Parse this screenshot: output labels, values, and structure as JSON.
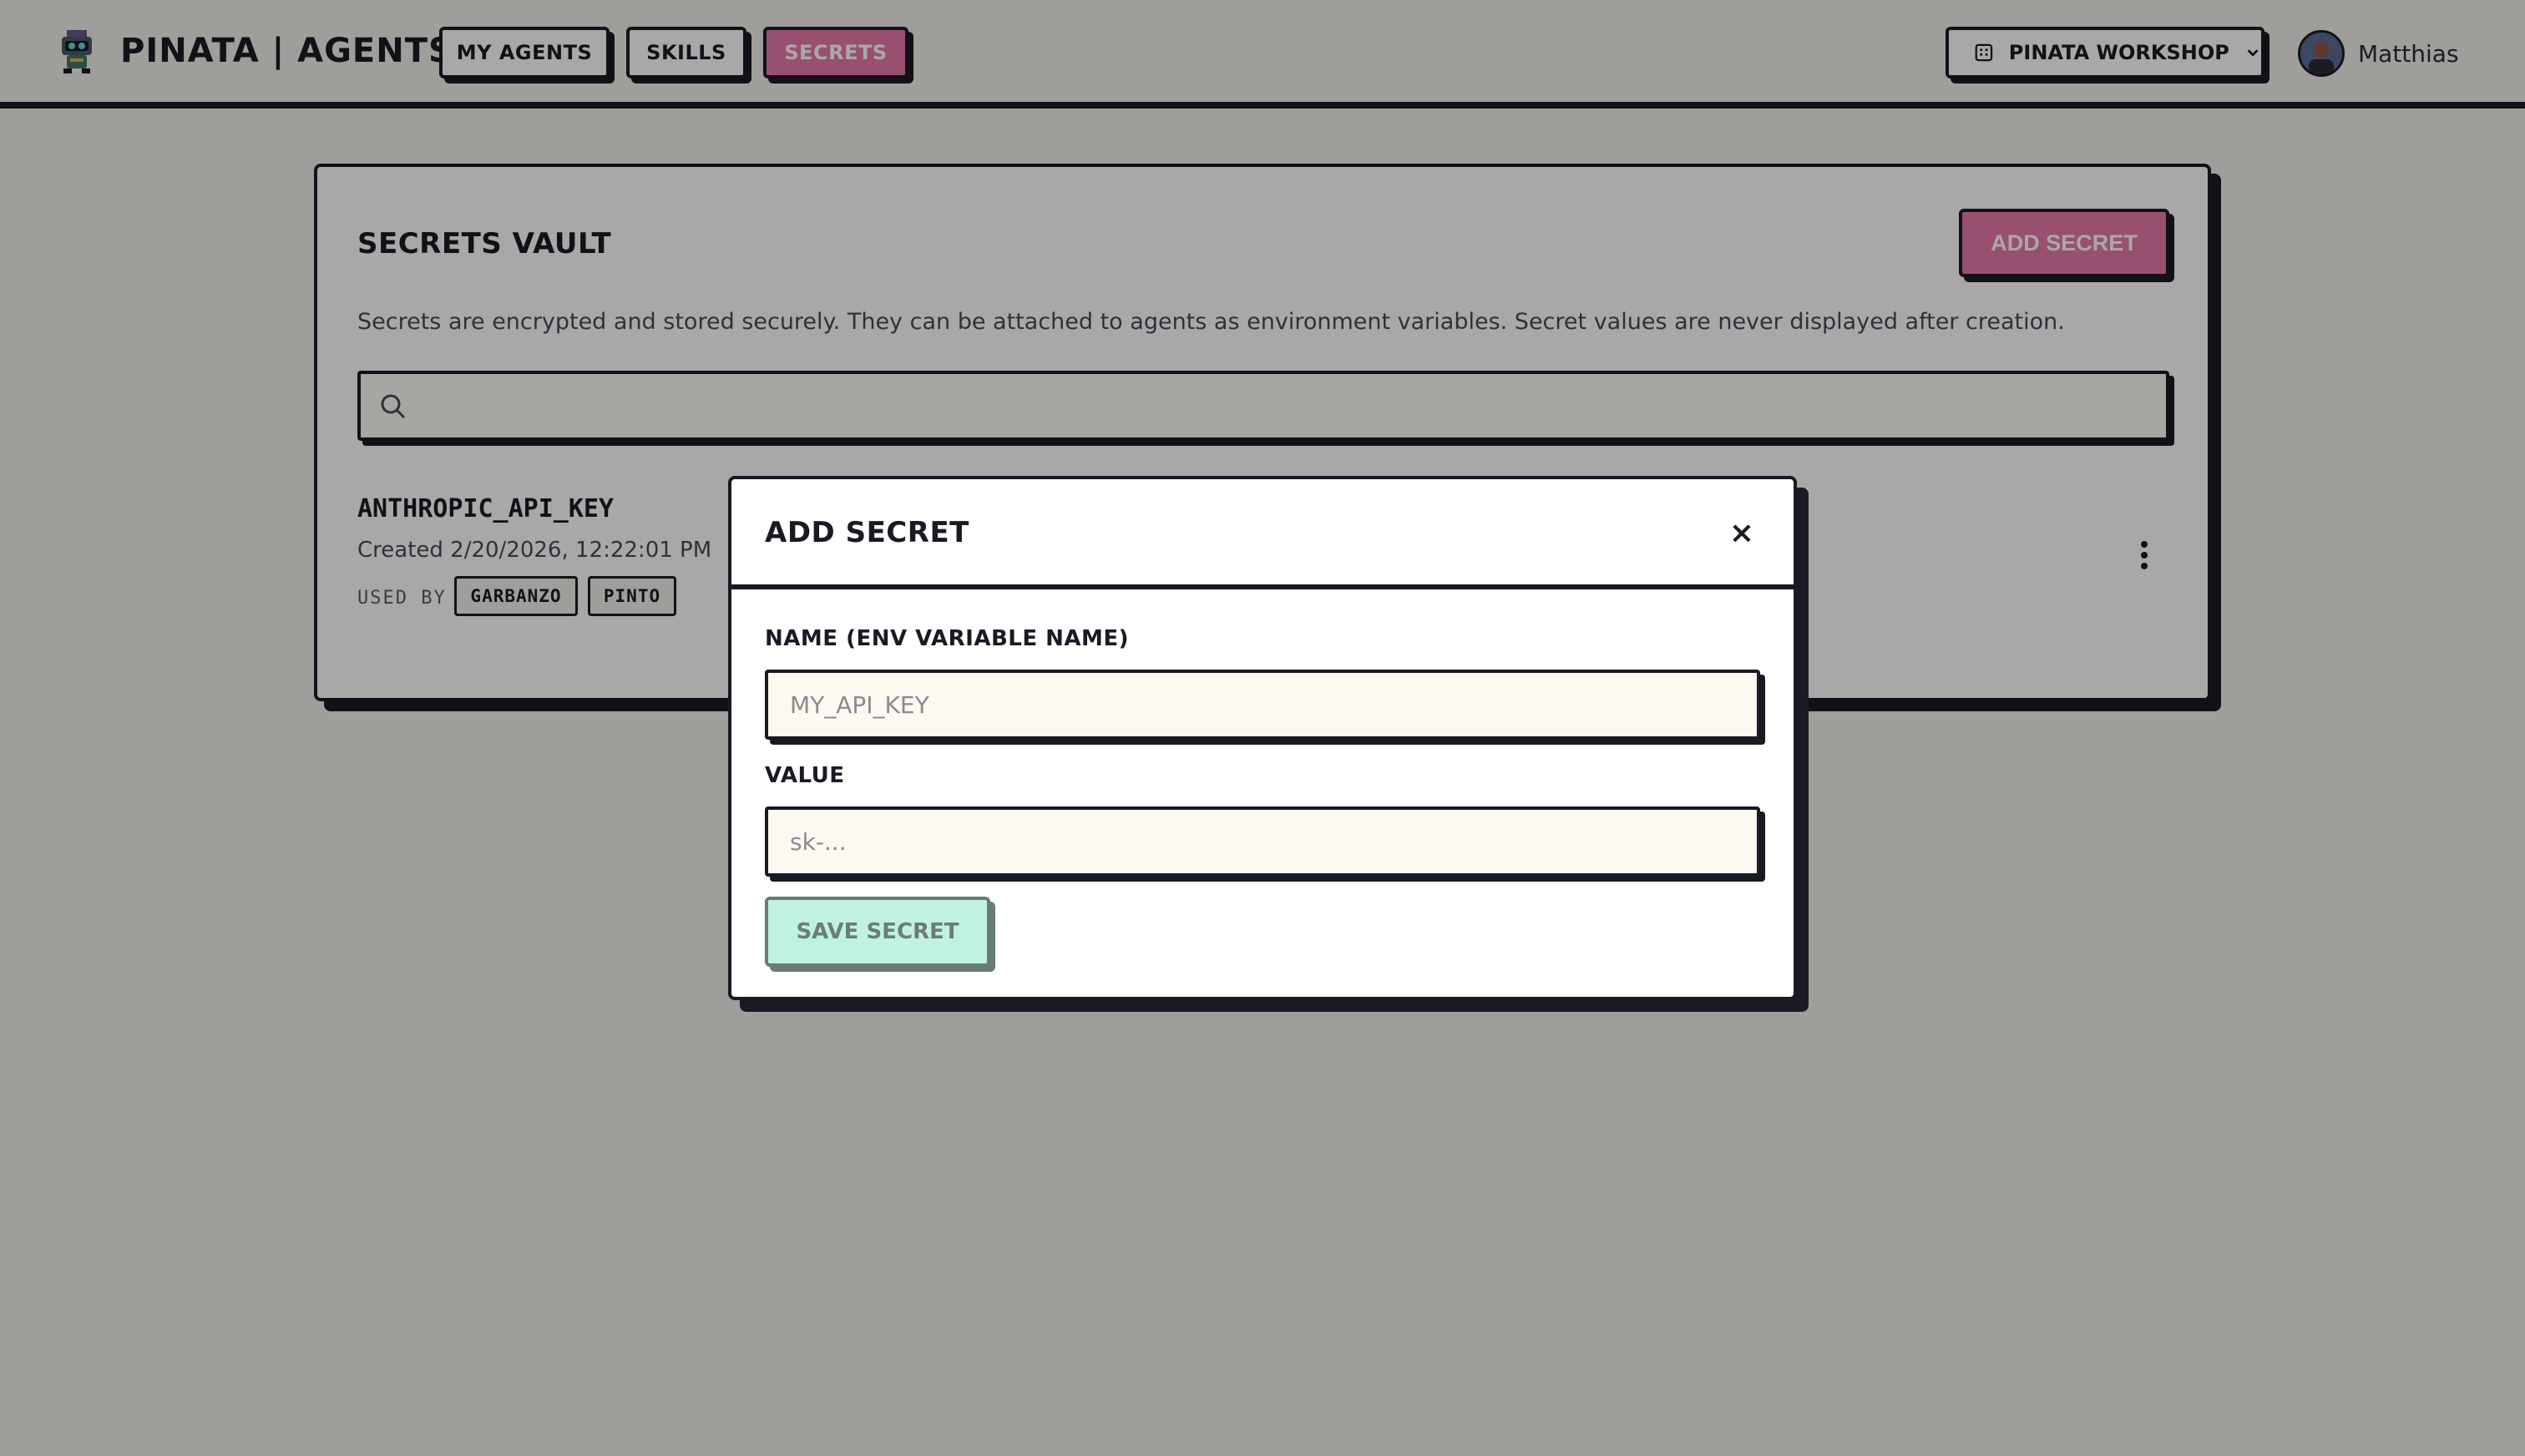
{
  "header": {
    "brand": "PINATA | AGENTS",
    "nav": [
      {
        "label": "MY AGENTS",
        "active": false
      },
      {
        "label": "SKILLS",
        "active": false
      },
      {
        "label": "SECRETS",
        "active": true
      }
    ],
    "workspace": "PINATA WORKSHOP",
    "user": "Matthias"
  },
  "vault": {
    "title": "SECRETS VAULT",
    "add_button": "ADD SECRET",
    "description": "Secrets are encrypted and stored securely. They can be attached to agents as environment variables. Secret values are never displayed after creation.",
    "search_value": "",
    "secrets": [
      {
        "name": "ANTHROPIC_API_KEY",
        "created": "Created 2/20/2026, 12:22:01 PM",
        "used_by_label": "USED BY",
        "agents": [
          "GARBANZO",
          "PINTO"
        ]
      }
    ]
  },
  "modal": {
    "title": "ADD SECRET",
    "close_glyph": "×",
    "name_label": "NAME (ENV VARIABLE NAME)",
    "name_placeholder": "MY_API_KEY",
    "value_label": "VALUE",
    "value_placeholder": "sk-...",
    "save_label": "SAVE SECRET"
  },
  "colors": {
    "accent_pink": "#e87aab",
    "save_mint": "#bff3e0",
    "ink": "#1a1a24",
    "background": "#f3f0ea"
  },
  "icons": {
    "logo": "pinata-robot-icon",
    "workspace": "building-icon",
    "workspace_chevron": "chevron-down-icon",
    "search": "search-icon",
    "row_menu": "more-vertical-icon",
    "close": "close-icon"
  }
}
